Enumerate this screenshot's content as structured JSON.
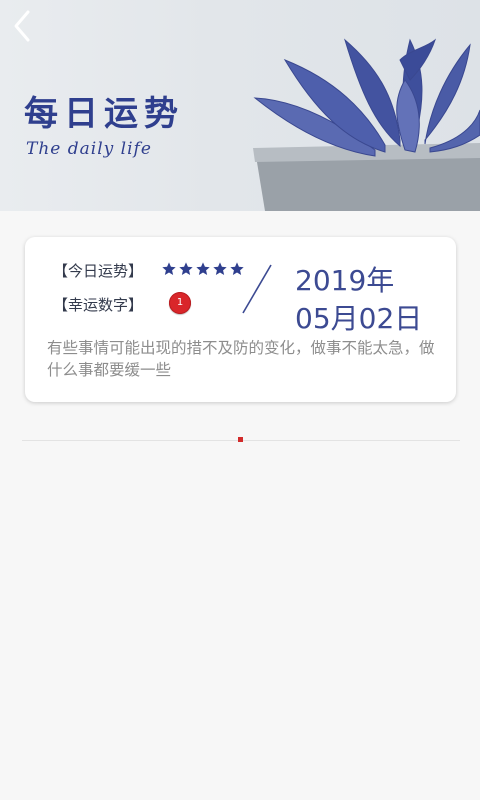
{
  "header": {
    "title": "每日运势",
    "subtitle": "The daily life",
    "back_icon": "chevron-left-icon"
  },
  "card": {
    "fortune_label": "【今日运势】",
    "fortune_stars": 5,
    "lucky_label": "【幸运数字】",
    "lucky_number": "1",
    "date_year": "2019年",
    "date_day": "05月02日",
    "description": "有些事情可能出现的措不及防的变化，做事不能太急，做什么事都要缓一些"
  },
  "colors": {
    "accent": "#2f3f8e",
    "badge": "#d9262a",
    "separator_dot": "#d22b2b"
  }
}
